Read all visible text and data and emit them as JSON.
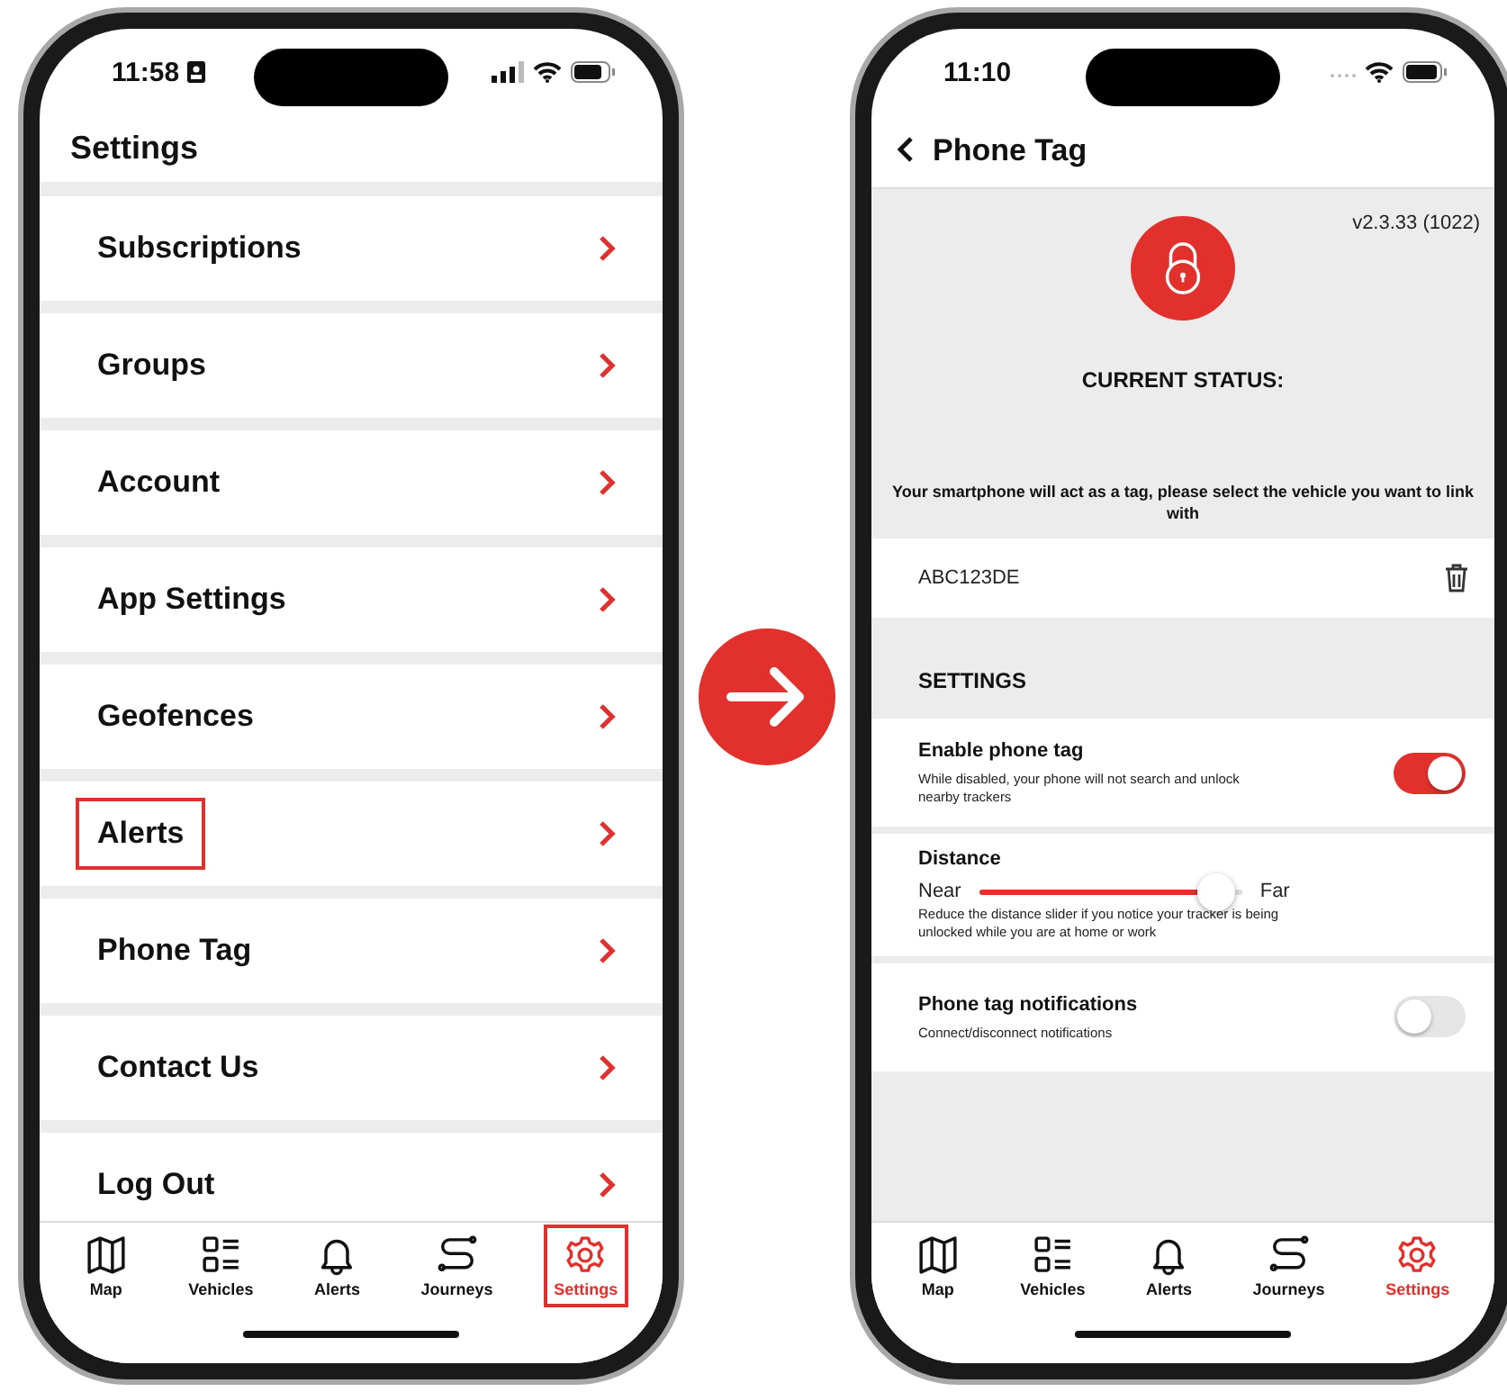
{
  "left_phone": {
    "status_bar": {
      "time": "11:58"
    },
    "title": "Settings",
    "items": [
      {
        "label": "Subscriptions",
        "highlighted": false
      },
      {
        "label": "Groups",
        "highlighted": false
      },
      {
        "label": "Account",
        "highlighted": false
      },
      {
        "label": "App Settings",
        "highlighted": false
      },
      {
        "label": "Geofences",
        "highlighted": false
      },
      {
        "label": "Alerts",
        "highlighted": true
      },
      {
        "label": "Phone Tag",
        "highlighted": false
      },
      {
        "label": "Contact Us",
        "highlighted": false
      },
      {
        "label": "Log Out",
        "highlighted": false
      }
    ],
    "tabs": [
      {
        "label": "Map",
        "selected": false,
        "highlighted": false
      },
      {
        "label": "Vehicles",
        "selected": false,
        "highlighted": false
      },
      {
        "label": "Alerts",
        "selected": false,
        "highlighted": false
      },
      {
        "label": "Journeys",
        "selected": false,
        "highlighted": false
      },
      {
        "label": "Settings",
        "selected": true,
        "highlighted": true
      }
    ]
  },
  "right_phone": {
    "status_bar": {
      "time": "11:10"
    },
    "title": "Phone Tag",
    "version": "v2.3.33 (1022)",
    "status_heading": "CURRENT STATUS:",
    "prompt": "Your smartphone will act as a tag, please select the vehicle you want to link with",
    "vehicle": "ABC123DE",
    "section_title": "SETTINGS",
    "settings": [
      {
        "kind": "toggle",
        "title": "Enable phone tag",
        "description": "While disabled, your phone will not search and unlock nearby trackers",
        "on": true
      },
      {
        "kind": "slider",
        "title": "Distance",
        "min_label": "Near",
        "max_label": "Far",
        "level": 0.9,
        "description": "Reduce the distance slider if you notice your tracker is being unlocked while you are at home or work"
      },
      {
        "kind": "toggle",
        "title": "Phone tag notifications",
        "description": "Connect/disconnect notifications",
        "on": false
      }
    ],
    "tabs": [
      {
        "label": "Map",
        "selected": false,
        "highlighted": false
      },
      {
        "label": "Vehicles",
        "selected": false,
        "highlighted": false
      },
      {
        "label": "Alerts",
        "selected": false,
        "highlighted": false
      },
      {
        "label": "Journeys",
        "selected": false,
        "highlighted": false
      },
      {
        "label": "Settings",
        "selected": true,
        "highlighted": false
      }
    ]
  }
}
